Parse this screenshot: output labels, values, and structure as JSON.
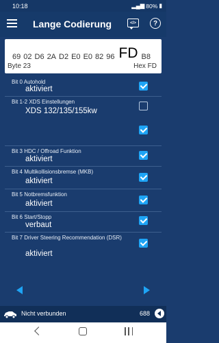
{
  "status": {
    "time": "10:18",
    "battery": "80%"
  },
  "app": {
    "title": "Lange Codierung"
  },
  "hex": {
    "bytes_before": [
      "69",
      "02",
      "D6",
      "2A",
      "D2",
      "E0",
      "E0",
      "82",
      "96"
    ],
    "selected": "FD",
    "bytes_after": [
      "B8"
    ],
    "byte_label": "Byte 23",
    "hex_label": "Hex FD"
  },
  "bits": [
    {
      "label": "Bit 0 Autohold",
      "value": "aktiviert",
      "checked": true
    },
    {
      "label": "Bit 1-2 XDS Einstellungen",
      "value": "XDS 132/135/155kw",
      "checked": false,
      "checked2": true
    },
    {
      "label": "Bit 3 HDC / Offroad Funktion",
      "value": "aktiviert",
      "checked": true
    },
    {
      "label": "Bit 4 Multikollisionsbremse (MKB)",
      "value": "aktiviert",
      "checked": true
    },
    {
      "label": "Bit 5 Notbremsfunktion",
      "value": "aktiviert",
      "checked": true
    },
    {
      "label": "Bit 6 Start/Stopp",
      "value": "verbaut",
      "checked": true
    },
    {
      "label": "Bit 7 Driver Steering Recommendation (DSR)",
      "value": "aktiviert",
      "checked": true
    }
  ],
  "footer": {
    "connection": "Nicht verbunden",
    "count": "688"
  },
  "icons": {
    "menu": "hamburger-icon",
    "code": "code-icon",
    "help": "help-icon",
    "car": "car-icon",
    "prev": "arrow-left-icon",
    "next": "arrow-right-icon"
  },
  "colors": {
    "accent": "#1ea4f5",
    "background": "#1a3c6e"
  }
}
